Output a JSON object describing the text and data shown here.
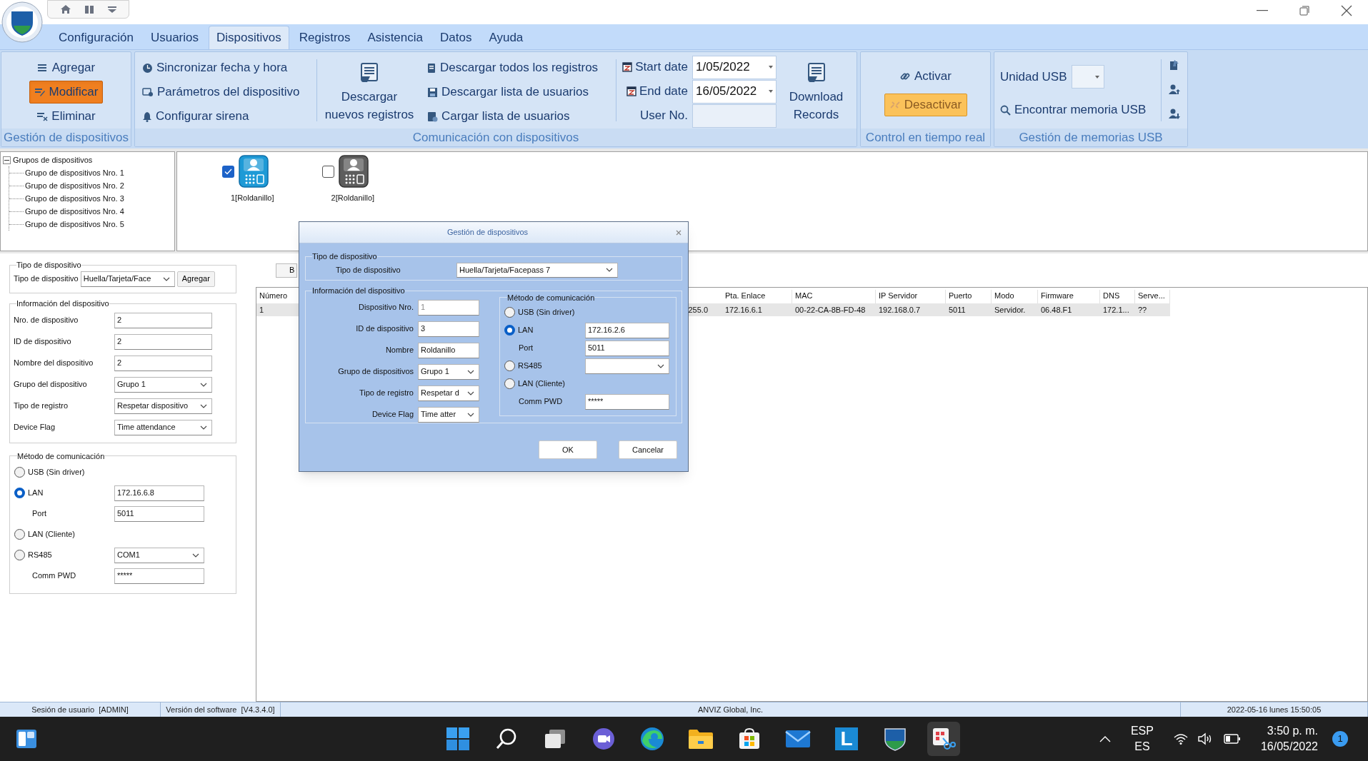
{
  "menu_tabs": [
    {
      "label": "Configuración",
      "selected": false
    },
    {
      "label": "Usuarios",
      "selected": false
    },
    {
      "label": "Dispositivos",
      "selected": true
    },
    {
      "label": "Registros",
      "selected": false
    },
    {
      "label": "Asistencia",
      "selected": false
    },
    {
      "label": "Datos",
      "selected": false
    },
    {
      "label": "Ayuda",
      "selected": false
    }
  ],
  "ribbon": {
    "device_management": {
      "label": "Gestión de dispositivos",
      "buttons": [
        {
          "label": "Agregar",
          "active": false
        },
        {
          "label": "Modificar",
          "active": true
        },
        {
          "label": "Eliminar",
          "active": false
        }
      ]
    },
    "communication": {
      "label": "Comunicación con dispositivos",
      "column_1": [
        "Sincronizar fecha y hora",
        "Parámetros del dispositivo",
        "Configurar sirena"
      ],
      "download_new": [
        "Descargar",
        "nuevos registros"
      ],
      "column_2": [
        "Descargar todos los registros",
        "Descargar lista de usuarios",
        "Cargar lista de usuarios"
      ],
      "filters": [
        {
          "kind": "date",
          "label": "Start date",
          "value": "1/05/2022"
        },
        {
          "kind": "date",
          "label": "End date",
          "value": "16/05/2022"
        },
        {
          "kind": "text",
          "label": "User No."
        }
      ],
      "download_records": [
        "Download",
        "Records"
      ]
    },
    "realtime": {
      "label": "Control en tiempo real",
      "buttons": [
        {
          "label": "Activar",
          "active": false,
          "disabled": false
        },
        {
          "label": "Desactivar",
          "active": true,
          "disabled": true
        }
      ]
    },
    "usb": {
      "label": "Gestión de memorias USB",
      "drive_label": "Unidad USB",
      "find": "Encontrar memoria USB"
    }
  },
  "device_tree": {
    "label": "Grupos de dispositivos",
    "expanded": true,
    "children": [
      {
        "label": "Grupo de dispositivos Nro. 1"
      },
      {
        "label": "Grupo de dispositivos Nro. 2"
      },
      {
        "label": "Grupo de dispositivos Nro. 3"
      },
      {
        "label": "Grupo de dispositivos Nro. 4"
      },
      {
        "label": "Grupo de dispositivos Nro. 5"
      }
    ]
  },
  "devices": [
    {
      "label": "1[Roldanillo]",
      "checked": true,
      "online": true
    },
    {
      "label": "2[Roldanillo]",
      "checked": false,
      "online": false
    }
  ],
  "device_form": {
    "type_group": {
      "legend": "Tipo de dispositivo",
      "label": "Tipo de dispositivo",
      "value": "Huella/Tarjeta/Face",
      "button": "Agregar"
    },
    "info_group": {
      "legend": "Información del dispositivo",
      "fields": [
        {
          "label": "Nro. de dispositivo",
          "kind": "text",
          "value": "2"
        },
        {
          "label": "ID de dispositivo",
          "kind": "text",
          "value": "2"
        },
        {
          "label": "Nombre del dispositivo",
          "kind": "text",
          "value": "2"
        },
        {
          "label": "Grupo del dispositivo",
          "kind": "select",
          "value": "Grupo 1"
        },
        {
          "label": "Tipo de registro",
          "kind": "select",
          "value": "Respetar dispositivo"
        },
        {
          "label": "Device Flag",
          "kind": "select",
          "value": "Time attendance"
        }
      ]
    },
    "comm_group": {
      "legend": "Método de comunicación",
      "rows": [
        {
          "kind": "radio",
          "label": "USB (Sin driver)",
          "selected": false
        },
        {
          "kind": "radio",
          "label": "LAN",
          "selected": true,
          "field": {
            "kind": "text",
            "value": "172.16.6.8"
          }
        },
        {
          "kind": "label",
          "label": "Port",
          "field": {
            "kind": "text",
            "value": "5011"
          }
        },
        {
          "kind": "radio",
          "label": "LAN (Cliente)",
          "selected": false
        },
        {
          "kind": "radio",
          "label": "RS485",
          "selected": false,
          "field": {
            "kind": "select",
            "value": "COM1"
          }
        },
        {
          "kind": "label",
          "label": "Comm PWD",
          "field": {
            "kind": "text",
            "value": "*****"
          }
        }
      ]
    }
  },
  "table_toolbar": {
    "button": "B"
  },
  "table": {
    "columns": [
      "Número",
      "Pta. Enlace",
      "MAC",
      "IP Servidor",
      "Puerto",
      "Modo",
      "Firmware",
      "DNS",
      "Serve..."
    ],
    "rows": [
      {
        "selected": true,
        "partial_cell": "255.0",
        "cells": [
          "1",
          "172.16.6.1",
          "00-22-CA-8B-FD-48",
          "192.168.0.7",
          "5011",
          "Servidor.",
          "06.48.F1",
          "172.1...",
          "??"
        ]
      }
    ]
  },
  "dialog": {
    "title": "Gestión de dispositivos",
    "type_group": {
      "legend": "Tipo de dispositivo",
      "label": "Tipo de dispositivo",
      "value": "Huella/Tarjeta/Facepass 7"
    },
    "info_group": {
      "legend": "Información del dispositivo",
      "fields": [
        {
          "label": "Dispositivo Nro.",
          "kind": "text",
          "value": "1",
          "disabled": true
        },
        {
          "label": "ID de dispositivo",
          "kind": "text",
          "value": "3",
          "disabled": false
        },
        {
          "label": "Nombre",
          "kind": "text",
          "value": "Roldanillo",
          "disabled": false
        },
        {
          "label": "Grupo de dispositivos",
          "kind": "select",
          "value": "Grupo 1",
          "disabled": false
        },
        {
          "label": "Tipo de registro",
          "kind": "select",
          "value": "Respetar d",
          "disabled": false
        },
        {
          "label": "Device Flag",
          "kind": "select",
          "value": "Time atter",
          "disabled": false
        }
      ]
    },
    "comm_group": {
      "legend": "Método de comunicación",
      "rows": [
        {
          "kind": "radio",
          "label": "USB (Sin driver)",
          "selected": false
        },
        {
          "kind": "radio",
          "label": "LAN",
          "selected": true,
          "field": {
            "kind": "text",
            "value": "172.16.2.6"
          }
        },
        {
          "kind": "label",
          "label": "Port",
          "field": {
            "kind": "text",
            "value": "5011"
          }
        },
        {
          "kind": "radio",
          "label": "RS485",
          "selected": false,
          "field": {
            "kind": "select"
          }
        },
        {
          "kind": "radio",
          "label": "LAN (Cliente)",
          "selected": false
        },
        {
          "kind": "label",
          "label": "Comm PWD",
          "field": {
            "kind": "text",
            "value": "*****"
          }
        }
      ]
    },
    "buttons": [
      "OK",
      "Cancelar"
    ]
  },
  "status_bar": [
    "Sesión de usuario  [ADMIN]",
    "Versión del software  [V4.3.4.0]",
    "ANVIZ Global, Inc.",
    "2022-05-16 lunes 15:50:05"
  ],
  "taskbar": {
    "apps": [
      {
        "kind": "windows",
        "active": false
      },
      {
        "kind": "search",
        "active": false
      },
      {
        "kind": "task-view",
        "active": false
      },
      {
        "kind": "chat",
        "active": false
      },
      {
        "kind": "browser",
        "active": false
      },
      {
        "kind": "folder",
        "active": false
      },
      {
        "kind": "store",
        "active": false
      },
      {
        "kind": "mail",
        "active": false
      },
      {
        "kind": "letter",
        "label": "L",
        "active": false
      },
      {
        "kind": "shield",
        "active": false
      },
      {
        "kind": "snip",
        "active": true
      }
    ],
    "language": [
      "ESP",
      "ES"
    ],
    "time": "3:50 p. m.",
    "date": "16/05/2022",
    "notifications": "1"
  }
}
